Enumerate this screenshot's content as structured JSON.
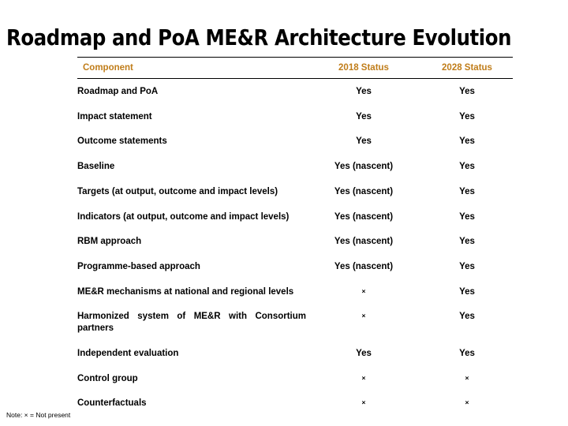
{
  "slide": {
    "title": "Roadmap and PoA ME&R Architecture Evolution",
    "note": "Note:  × = Not present"
  },
  "table": {
    "headers": {
      "component": "Component",
      "status_2018": "2018 Status",
      "status_2028": "2028 Status"
    },
    "header_color": "#c07d1a",
    "rule_color": "#000000",
    "rows": [
      {
        "component": "Roadmap and PoA",
        "status_2018": "Yes",
        "status_2028": "Yes",
        "multiline": false
      },
      {
        "component": "Impact statement",
        "status_2018": "Yes",
        "status_2028": "Yes",
        "multiline": false
      },
      {
        "component": "Outcome statements",
        "status_2018": "Yes",
        "status_2028": "Yes",
        "multiline": false
      },
      {
        "component": "Baseline",
        "status_2018": "Yes (nascent)",
        "status_2028": "Yes",
        "multiline": false
      },
      {
        "component": "Targets (at output, outcome and impact levels)",
        "status_2018": "Yes (nascent)",
        "status_2028": "Yes",
        "multiline": true
      },
      {
        "component": "Indicators (at output, outcome and impact levels)",
        "status_2018": "Yes (nascent)",
        "status_2028": "Yes",
        "multiline": true
      },
      {
        "component": "RBM approach",
        "status_2018": "Yes (nascent)",
        "status_2028": "Yes",
        "multiline": false
      },
      {
        "component": "Programme-based approach",
        "status_2018": "Yes (nascent)",
        "status_2028": "Yes",
        "multiline": false
      },
      {
        "component": "ME&R mechanisms at national and regional levels",
        "status_2018": "×",
        "status_2028": "Yes",
        "multiline": true
      },
      {
        "component": "Harmonized system of ME&R with Consortium partners",
        "status_2018": "×",
        "status_2028": "Yes",
        "multiline": true
      },
      {
        "component": "Independent evaluation",
        "status_2018": "Yes",
        "status_2028": "Yes",
        "multiline": false
      },
      {
        "component": "Control group",
        "status_2018": "×",
        "status_2028": "×",
        "multiline": false
      },
      {
        "component": "Counterfactuals",
        "status_2018": "×",
        "status_2028": "×",
        "multiline": false
      }
    ]
  }
}
